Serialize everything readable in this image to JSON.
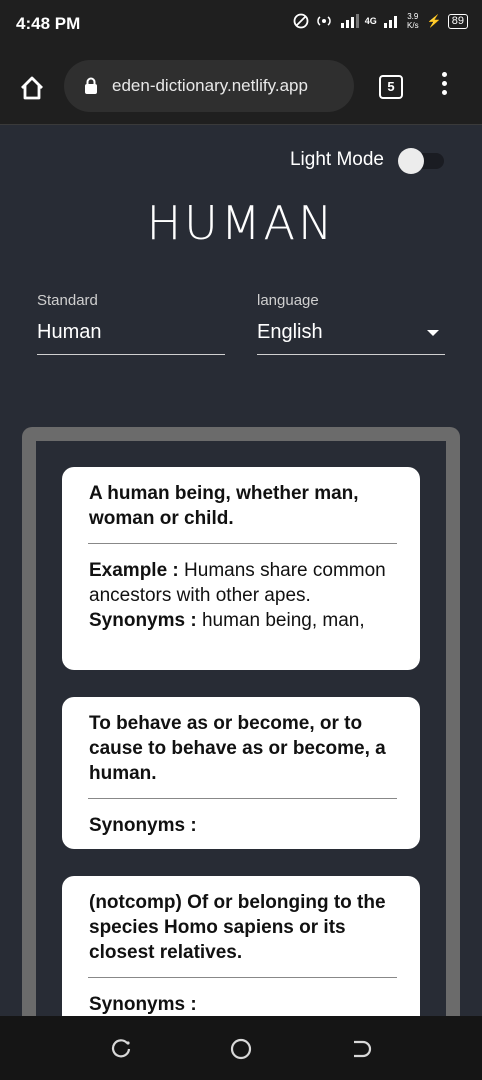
{
  "status_bar": {
    "time": "4:48 PM",
    "net_speed": "3.9 K/s",
    "signal_label": "4G",
    "battery": "89"
  },
  "browser": {
    "url": "eden-dictionary.netlify.app",
    "tab_count": "5"
  },
  "page": {
    "mode_label": "Light Mode",
    "title": "HUMAN",
    "standard_label": "Standard",
    "standard_value": "Human",
    "language_label": "language",
    "language_value": "English"
  },
  "definitions": [
    {
      "definition": "A human being, whether man, woman or child.",
      "example_label": "Example :",
      "example": "Humans share common ancestors with other apes.",
      "synonyms_label": "Synonyms :",
      "synonyms": "human being, man,"
    },
    {
      "definition": "To behave as or become, or to cause to behave as or become, a human.",
      "synonyms_label": "Synonyms :",
      "synonyms": ""
    },
    {
      "definition": "(notcomp) Of or belonging to the species Homo sapiens or its closest relatives.",
      "synonyms_label": "Synonyms :",
      "synonyms": ""
    }
  ],
  "icons": {
    "home": "home-icon",
    "lock": "lock-icon",
    "tabs": "tabs-icon",
    "menu": "more-vert-icon",
    "recents": "recents-icon",
    "nav_home": "circle-home-icon",
    "back": "back-icon"
  },
  "colors": {
    "background": "#282c35",
    "card": "#ffffff",
    "frame": "#6b6b6b"
  }
}
